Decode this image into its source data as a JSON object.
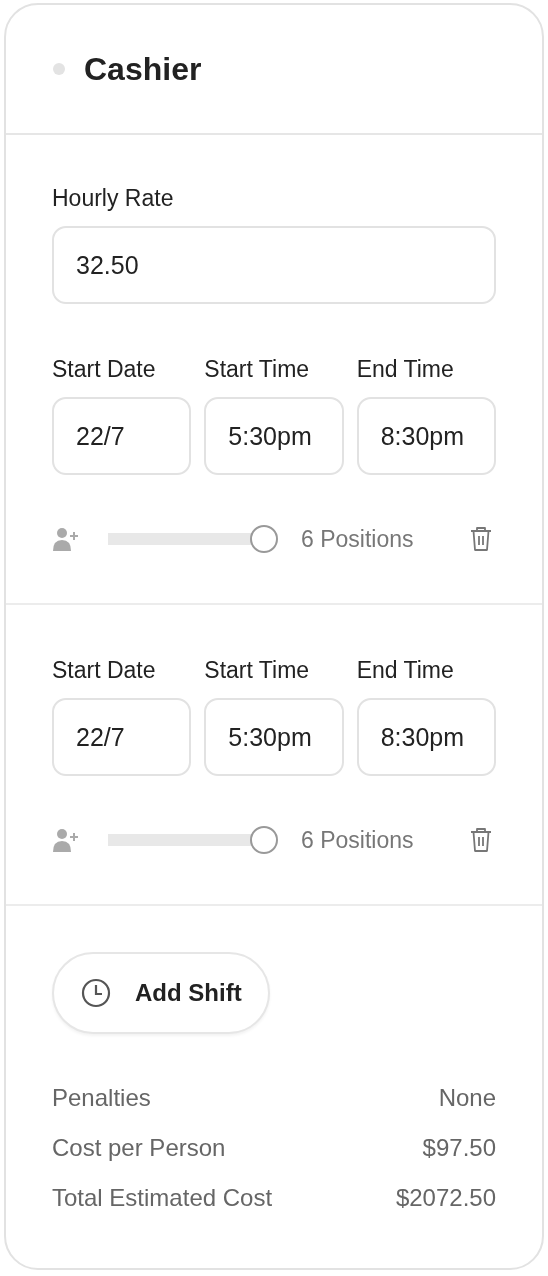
{
  "role": {
    "title": "Cashier"
  },
  "hourly_rate": {
    "label": "Hourly Rate",
    "value": "32.50"
  },
  "shifts": [
    {
      "fields": [
        {
          "label": "Start Date",
          "value": "22/7"
        },
        {
          "label": "Start Time",
          "value": "5:30pm"
        },
        {
          "label": "End Time",
          "value": "8:30pm"
        }
      ],
      "positions": {
        "level": 1,
        "reading": "6 Positions"
      }
    },
    {
      "fields": [
        {
          "label": "Start Date",
          "value": "22/7"
        },
        {
          "label": "Start Time",
          "value": "5:30pm"
        },
        {
          "label": "End Time",
          "value": "8:30pm"
        }
      ],
      "positions": {
        "level": 1,
        "reading": "6 Positions"
      }
    }
  ],
  "add_button": "Add Shift",
  "summary": [
    {
      "label": "Penalties",
      "value": "None"
    },
    {
      "label": "Cost per Person",
      "value": "$97.50"
    },
    {
      "label": "Total Estimated Cost",
      "value": "$2072.50"
    }
  ]
}
